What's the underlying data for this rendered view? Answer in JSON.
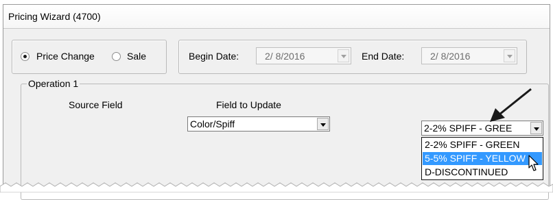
{
  "window": {
    "title": "Pricing Wizard (4700)"
  },
  "mode": {
    "options": [
      {
        "label": "Price Change",
        "selected": true
      },
      {
        "label": "Sale",
        "selected": false
      }
    ]
  },
  "dates": {
    "begin_label": "Begin Date:",
    "begin_value": "2/ 8/2016",
    "end_label": "End Date:",
    "end_value": "2/ 8/2016"
  },
  "operation": {
    "title": "Operation 1",
    "source_field_label": "Source Field",
    "field_to_update_label": "Field to Update",
    "field_to_update_value": "Color/Spiff",
    "value_select": "2-2% SPIFF - GREE",
    "options": [
      {
        "label": "2-2% SPIFF - GREEN",
        "highlighted": false
      },
      {
        "label": "5-5% SPIFF - YELLOW",
        "highlighted": true
      },
      {
        "label": "D-DISCONTINUED",
        "highlighted": false
      }
    ]
  },
  "colors": {
    "highlight": "#3399ff",
    "arrow": "#1a1a1a"
  }
}
